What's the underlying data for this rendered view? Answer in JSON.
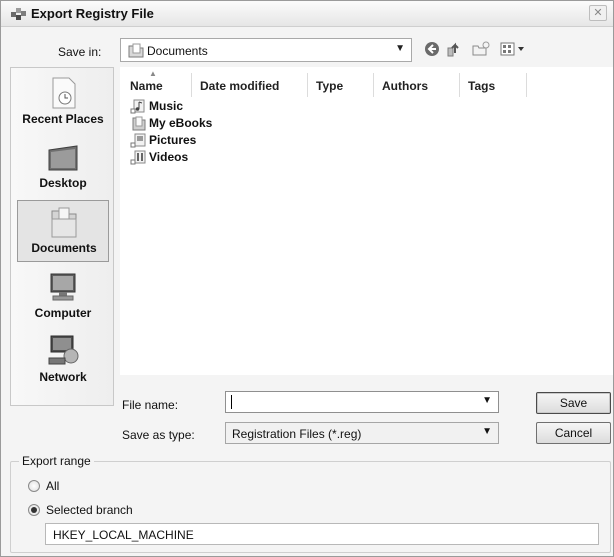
{
  "window": {
    "title": "Export Registry File",
    "close_glyph": "✕"
  },
  "save_in": {
    "label": "Save in:",
    "value": "Documents",
    "arrow": "▼"
  },
  "toolbar": {
    "icons": [
      "back-icon",
      "up-folder-icon",
      "new-folder-icon",
      "views-menu-icon"
    ]
  },
  "places": [
    {
      "label": "Recent Places",
      "icon": "recent-places-icon"
    },
    {
      "label": "Desktop",
      "icon": "desktop-icon"
    },
    {
      "label": "Documents",
      "icon": "documents-icon",
      "selected": true
    },
    {
      "label": "Computer",
      "icon": "computer-icon"
    },
    {
      "label": "Network",
      "icon": "network-icon"
    }
  ],
  "columns": [
    "Name",
    "Date modified",
    "Type",
    "Authors",
    "Tags"
  ],
  "files": [
    {
      "name": "Music",
      "icon": "music-folder-icon"
    },
    {
      "name": "My eBooks",
      "icon": "folder-icon"
    },
    {
      "name": "Pictures",
      "icon": "pictures-folder-icon"
    },
    {
      "name": "Videos",
      "icon": "videos-folder-icon"
    }
  ],
  "file_name": {
    "label": "File name:",
    "value": "",
    "arrow": "▼"
  },
  "save_as_type": {
    "label": "Save as type:",
    "value": "Registration Files (*.reg)",
    "arrow": "▼"
  },
  "buttons": {
    "save": "Save",
    "cancel": "Cancel"
  },
  "export_range": {
    "title": "Export range",
    "all_label": "All",
    "selected_branch_label": "Selected branch",
    "selected": "selected_branch",
    "branch_value": "HKEY_LOCAL_MACHINE"
  }
}
